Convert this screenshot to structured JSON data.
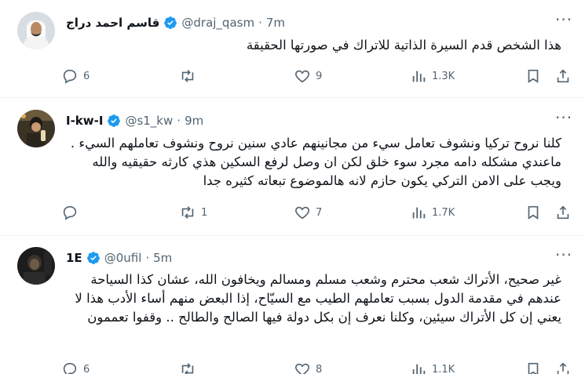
{
  "tweets": [
    {
      "name": "قاسم احمد دراج",
      "handle": "@draj_qasm",
      "dot": "·",
      "time": "7m",
      "text": "هذا الشخص قدم السيرة الذاتية للاتراك في صورتها الحقيقة",
      "replies": "6",
      "retweets": "",
      "likes": "9",
      "views": "1.3K"
    },
    {
      "name": "I-kw-I",
      "handle": "@s1_kw",
      "dot": "·",
      "time": "9m",
      "text": "كلنا نروح تركيا ونشوف تعامل سيء من مجانينهم عادي سنين نروح ونشوف تعاملهم السيء . ماعندي مشكله دامه مجرد سوء خلق لكن ان وصل لرفع السكين هذي كارثه حقيقيه والله  ويجب على الامن التركي يكون حازم لانه هالموضوع تبعاته كثيره جدا",
      "replies": "",
      "retweets": "1",
      "likes": "7",
      "views": "1.7K"
    },
    {
      "name": "1E",
      "handle": "@0ufil",
      "dot": "·",
      "time": "5m",
      "text": "غير صحيح، الأتراك شعب محترم وشعب مسلم ومسالم ويخافون الله، عشان كذا السياحة عندهم في مقدمة الدول بسبب تعاملهم الطيب مع السيّاح، إذا البعض منهم أساء الأدب هذا لا يعني إن كل الأتراك سيئين، وكلنا نعرف إن بكل دولة فيها الصالح والطالح .. وقفوا تعممون",
      "replies": "6",
      "retweets": "",
      "likes": "8",
      "views": "1.1K"
    }
  ],
  "colors": {
    "verified": "#1d9bf0",
    "muted": "#536471",
    "text": "#0f1419",
    "divider": "#eff3f4"
  },
  "icons": [
    "verified-badge-icon",
    "more-icon",
    "reply-icon",
    "retweet-icon",
    "like-icon",
    "views-icon",
    "bookmark-icon",
    "share-icon"
  ]
}
